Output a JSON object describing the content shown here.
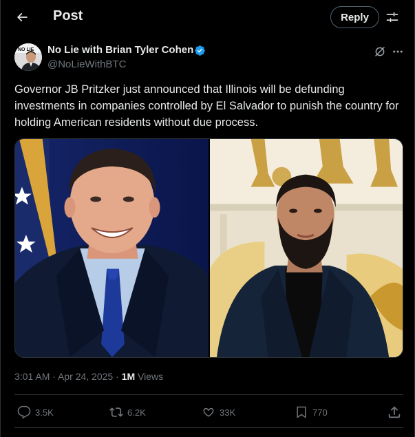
{
  "header": {
    "title": "Post",
    "reply_label": "Reply"
  },
  "author": {
    "name": "No Lie with Brian Tyler Cohen",
    "handle": "@NoLieWithBTC",
    "avatar_text": "NO LIE"
  },
  "tweet": {
    "text": "Governor JB Pritzker just announced that Illinois will be defunding investments in companies controlled by El Salvador to punish the country for holding American residents without due process."
  },
  "meta": {
    "timestamp": "3:01 AM · Apr 24, 2025 · ",
    "views_count": "1M",
    "views_label": " Views"
  },
  "actions": {
    "replies": "3.5K",
    "reposts": "6.2K",
    "likes": "33K",
    "bookmarks": "770"
  },
  "icons": {
    "back": "back-arrow-icon",
    "adjust": "adjust-icon",
    "verified": "verified-badge-icon",
    "grok": "grok-icon",
    "more": "more-icon",
    "reply": "reply-icon",
    "repost": "repost-icon",
    "like": "like-icon",
    "bookmark": "bookmark-icon",
    "share": "share-icon"
  },
  "colors": {
    "background": "#000000",
    "text": "#e7e9ea",
    "secondary": "#71767b",
    "verified": "#1d9bf0",
    "border": "#2f3336"
  }
}
